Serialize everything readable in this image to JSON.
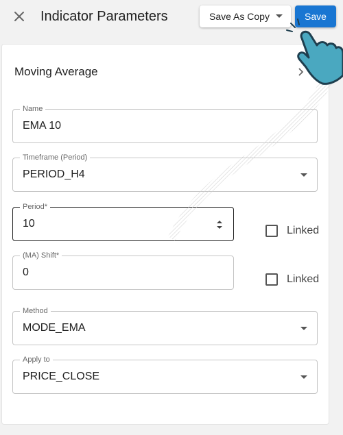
{
  "header": {
    "title": "Indicator Parameters",
    "save_as_copy_label": "Save As Copy",
    "save_label": "Save"
  },
  "section": {
    "title": "Moving Average"
  },
  "fields": {
    "name": {
      "label": "Name",
      "value": "EMA 10"
    },
    "timeframe": {
      "label": "Timeframe (Period)",
      "value": "PERIOD_H4"
    },
    "period": {
      "label": "Period*",
      "value": "10"
    },
    "shift": {
      "label": "(MA) Shift*",
      "value": "0"
    },
    "method": {
      "label": "Method",
      "value": "MODE_EMA"
    },
    "apply_to": {
      "label": "Apply to",
      "value": "PRICE_CLOSE"
    }
  },
  "linked": {
    "period_label": "Linked",
    "shift_label": "Linked",
    "period_checked": false,
    "shift_checked": false
  },
  "icons": {
    "close": "close-icon",
    "dropdown": "chevron-down-icon",
    "section_arrow": "chevron-right-icon",
    "spinner": "spinner-icon",
    "pointer_hand": "pointer-hand-icon"
  },
  "colors": {
    "primary": "#1976d2",
    "hand_fill": "#4aa8c0",
    "background": "#f2f2f2"
  }
}
